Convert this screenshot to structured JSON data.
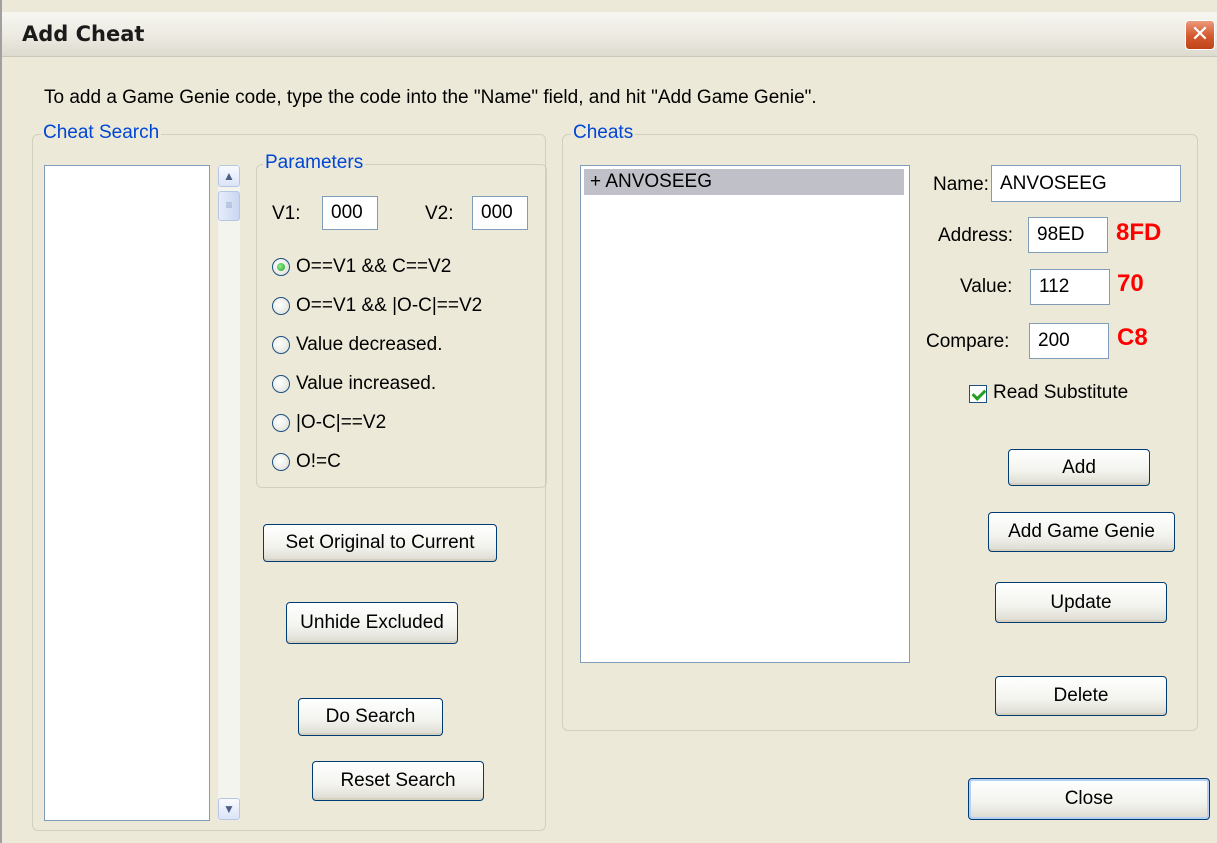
{
  "window": {
    "title": "Add Cheat",
    "close_glyph": "✕"
  },
  "instruction": "To add a Game Genie code, type the code into the \"Name\" field, and hit \"Add Game Genie\".",
  "cheat_search": {
    "legend": "Cheat Search",
    "parameters": {
      "legend": "Parameters",
      "v1_label": "V1:",
      "v1_value": "000",
      "v2_label": "V2:",
      "v2_value": "000",
      "options": [
        {
          "label": "O==V1 && C==V2",
          "checked": true
        },
        {
          "label": "O==V1 && |O-C|==V2",
          "checked": false
        },
        {
          "label": "Value decreased.",
          "checked": false
        },
        {
          "label": "Value increased.",
          "checked": false
        },
        {
          "label": "|O-C|==V2",
          "checked": false
        },
        {
          "label": "O!=C",
          "checked": false
        }
      ]
    },
    "buttons": {
      "set_original": "Set Original to Current",
      "unhide": "Unhide Excluded",
      "do_search": "Do Search",
      "reset_search": "Reset Search"
    }
  },
  "cheats": {
    "legend": "Cheats",
    "list": [
      "+ ANVOSEEG"
    ],
    "name_label": "Name:",
    "name_value": "ANVOSEEG",
    "address_label": "Address:",
    "address_value": "98ED",
    "address_hex": "8FD",
    "value_label": "Value:",
    "value_value": "112",
    "value_hex": "70",
    "compare_label": "Compare:",
    "compare_value": "200",
    "compare_hex": "C8",
    "read_substitute_label": "Read Substitute",
    "read_substitute_checked": true,
    "buttons": {
      "add": "Add",
      "add_game_genie": "Add Game Genie",
      "update": "Update",
      "delete": "Delete"
    }
  },
  "close_button": "Close",
  "colors": {
    "legend_blue": "#0046d5",
    "annotation_red": "#ff0000",
    "checked_green": "#21a121"
  }
}
